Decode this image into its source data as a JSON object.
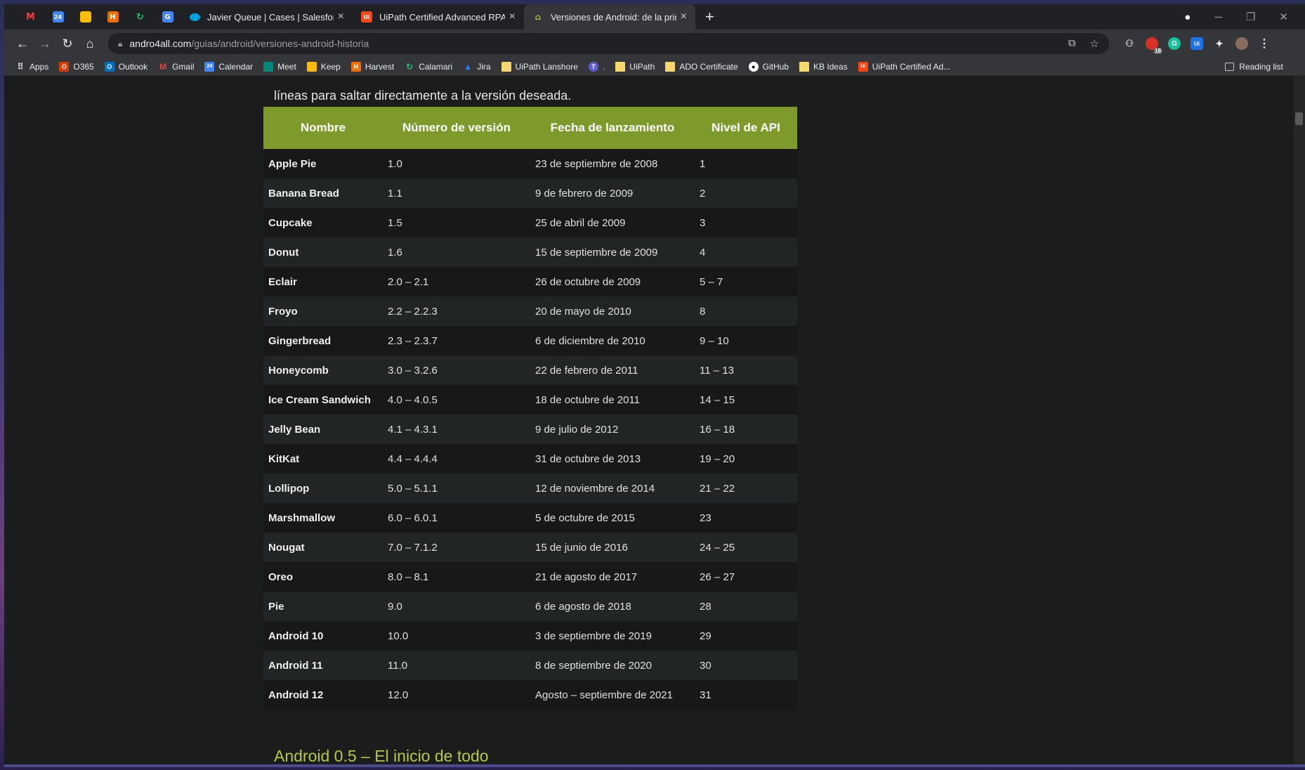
{
  "browser": {
    "tabs": [
      {
        "title": "Javier Queue | Cases | Salesforce",
        "close": "×"
      },
      {
        "title": "UiPath Certified Advanced RPA D",
        "close": "×"
      },
      {
        "title": "Versiones de Android: de la prim",
        "close": "×"
      }
    ],
    "new_tab": "+",
    "address": {
      "host": "andro4all.com",
      "path": "/guias/android/versiones-android-historia"
    },
    "extension_badge": "18"
  },
  "bookmarks": {
    "items": [
      "Apps",
      "O365",
      "Outlook",
      "Gmail",
      "Calendar",
      "Meet",
      "Keep",
      "Harvest",
      "Calamari",
      "Jira",
      "UiPath Lanshore",
      ".",
      "UiPath",
      "ADO Certificate",
      "GitHub",
      "KB Ideas",
      "UiPath Certified Ad..."
    ],
    "reading_list": "Reading list"
  },
  "page": {
    "intro_text": "líneas para saltar directamente a la versión deseada.",
    "table": {
      "headers": [
        "Nombre",
        "Número de versión",
        "Fecha de lanzamiento",
        "Nivel de API"
      ],
      "rows": [
        [
          "Apple Pie",
          "1.0",
          "23 de septiembre de 2008",
          "1"
        ],
        [
          "Banana Bread",
          "1.1",
          "9 de febrero de 2009",
          "2"
        ],
        [
          "Cupcake",
          "1.5",
          "25 de abril de 2009",
          "3"
        ],
        [
          "Donut",
          "1.6",
          "15 de septiembre de 2009",
          "4"
        ],
        [
          "Eclair",
          "2.0 – 2.1",
          "26 de octubre de 2009",
          "5 – 7"
        ],
        [
          "Froyo",
          "2.2 – 2.2.3",
          "20 de mayo de 2010",
          "8"
        ],
        [
          "Gingerbread",
          "2.3 – 2.3.7",
          "6 de diciembre de 2010",
          "9 – 10"
        ],
        [
          "Honeycomb",
          "3.0 – 3.2.6",
          "22 de febrero de 2011",
          "11 – 13"
        ],
        [
          "Ice Cream Sandwich",
          "4.0 – 4.0.5",
          "18 de octubre de 2011",
          "14 – 15"
        ],
        [
          "Jelly Bean",
          "4.1 – 4.3.1",
          "9 de julio de 2012",
          "16 – 18"
        ],
        [
          "KitKat",
          "4.4 – 4.4.4",
          "31 de octubre de 2013",
          "19 – 20"
        ],
        [
          "Lollipop",
          "5.0 – 5.1.1",
          "12 de noviembre de 2014",
          "21 – 22"
        ],
        [
          "Marshmallow",
          "6.0 – 6.0.1",
          "5 de octubre de 2015",
          "23"
        ],
        [
          "Nougat",
          "7.0 – 7.1.2",
          "15 de junio de 2016",
          "24 – 25"
        ],
        [
          "Oreo",
          "8.0 – 8.1",
          "21 de agosto de 2017",
          "26 – 27"
        ],
        [
          "Pie",
          "9.0",
          "6 de agosto de 2018",
          "28"
        ],
        [
          "Android 10",
          "10.0",
          "3 de septiembre de 2019",
          "29"
        ],
        [
          "Android 11",
          "11.0",
          "8 de septiembre de 2020",
          "30"
        ],
        [
          "Android 12",
          "12.0",
          "Agosto – septiembre de 2021",
          "31"
        ]
      ]
    },
    "section_heading": "Android 0.5 – El inicio de todo"
  },
  "colors": {
    "table_header": "#7d9a2b",
    "heading": "#b9c83c",
    "tab_bar": "#202124",
    "toolbar": "#35363a"
  }
}
